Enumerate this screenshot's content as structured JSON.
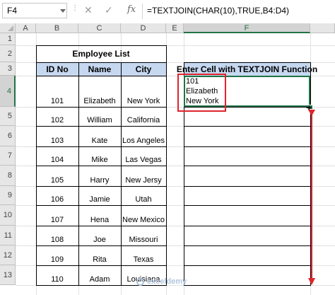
{
  "formula_bar": {
    "name_box": "F4",
    "cancel_icon": "✕",
    "enter_icon": "✓",
    "fx_label": "fx",
    "formula": "=TEXTJOIN(CHAR(10),TRUE,B4:D4)"
  },
  "columns": [
    "A",
    "B",
    "C",
    "D",
    "E",
    "F"
  ],
  "rows": [
    "1",
    "2",
    "3",
    "4",
    "5",
    "6",
    "7",
    "8",
    "9",
    "10",
    "11",
    "12",
    "13"
  ],
  "employee_table": {
    "title": "Employee List",
    "headers": [
      "ID No",
      "Name",
      "City"
    ],
    "rows": [
      [
        "101",
        "Elizabeth",
        "New York"
      ],
      [
        "102",
        "William",
        "California"
      ],
      [
        "103",
        "Kate",
        "Los Angeles"
      ],
      [
        "104",
        "Mike",
        "Las Vegas"
      ],
      [
        "105",
        "Harry",
        "New Jersy"
      ],
      [
        "106",
        "Jamie",
        "Utah"
      ],
      [
        "107",
        "Hena",
        "New Mexico"
      ],
      [
        "108",
        "Joe",
        "Missouri"
      ],
      [
        "109",
        "Rita",
        "Texas"
      ],
      [
        "110",
        "Adam",
        "Louisiana"
      ]
    ]
  },
  "textjoin_column": {
    "header": "Enter Cell with TEXTJOIN Function",
    "f4_lines": [
      "101",
      "Elizabeth",
      "New York"
    ]
  },
  "watermark": "exceldemy",
  "colors": {
    "header_fill": "#c6d8f0",
    "selection": "#217346",
    "annotation_red": "#e0242b"
  }
}
